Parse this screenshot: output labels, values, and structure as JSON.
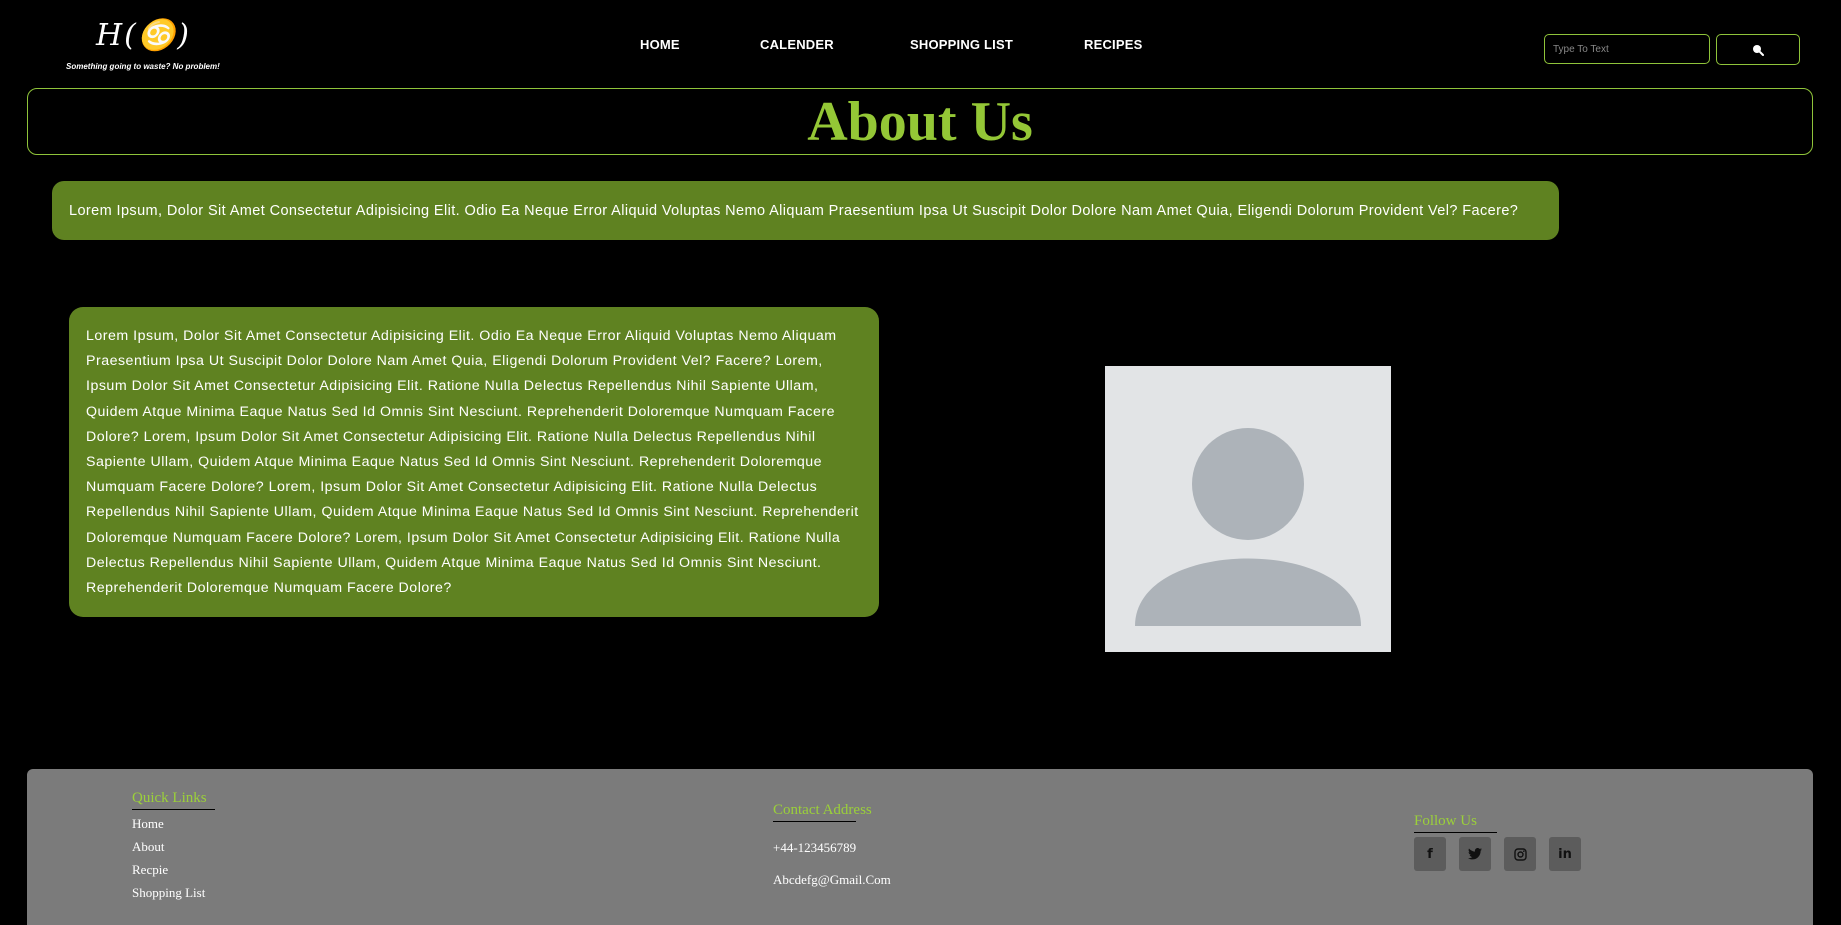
{
  "logo": {
    "mark": "H(♋)",
    "tagline": "Something going to waste? No problem!"
  },
  "nav": {
    "home": "HOME",
    "calender": "CALENDER",
    "shopping_list": "SHOPPING LIST",
    "recipes": "RECIPES"
  },
  "search": {
    "placeholder": "Type To Text"
  },
  "page": {
    "title": "About Us",
    "intro": "Lorem Ipsum, Dolor Sit Amet Consectetur Adipisicing Elit. Odio Ea Neque Error Aliquid Voluptas Nemo Aliquam Praesentium Ipsa Ut Suscipit Dolor Dolore Nam Amet Quia, Eligendi Dolorum Provident Vel? Facere?",
    "body": "Lorem Ipsum, Dolor Sit Amet Consectetur Adipisicing Elit. Odio Ea Neque Error Aliquid Voluptas Nemo Aliquam Praesentium Ipsa Ut Suscipit Dolor Dolore Nam Amet Quia, Eligendi Dolorum Provident Vel? Facere? Lorem, Ipsum Dolor Sit Amet Consectetur Adipisicing Elit. Ratione Nulla Delectus Repellendus Nihil Sapiente Ullam, Quidem Atque Minima Eaque Natus Sed Id Omnis Sint Nesciunt. Reprehenderit Doloremque Numquam Facere Dolore? Lorem, Ipsum Dolor Sit Amet Consectetur Adipisicing Elit. Ratione Nulla Delectus Repellendus Nihil Sapiente Ullam, Quidem Atque Minima Eaque Natus Sed Id Omnis Sint Nesciunt. Reprehenderit Doloremque Numquam Facere Dolore? Lorem, Ipsum Dolor Sit Amet Consectetur Adipisicing Elit. Ratione Nulla Delectus Repellendus Nihil Sapiente Ullam, Quidem Atque Minima Eaque Natus Sed Id Omnis Sint Nesciunt. Reprehenderit Doloremque Numquam Facere Dolore? Lorem, Ipsum Dolor Sit Amet Consectetur Adipisicing Elit. Ratione Nulla Delectus Repellendus Nihil Sapiente Ullam, Quidem Atque Minima Eaque Natus Sed Id Omnis Sint Nesciunt. Reprehenderit Doloremque Numquam Facere Dolore?"
  },
  "footer": {
    "quick_links": {
      "heading": "Quick Links",
      "items": [
        "Home",
        "About",
        "Recpie",
        "Shopping List"
      ]
    },
    "contact": {
      "heading": "Contact Address",
      "phone": "+44-123456789",
      "email": "Abcdefg@Gmail.Com"
    },
    "follow": {
      "heading": "Follow Us",
      "icons": [
        "facebook-icon",
        "twitter-icon",
        "instagram-icon",
        "linkedin-icon"
      ]
    }
  },
  "colors": {
    "accent": "#94c736",
    "panel": "#5f8221",
    "footer": "#7b7b7b",
    "background": "#000000"
  }
}
